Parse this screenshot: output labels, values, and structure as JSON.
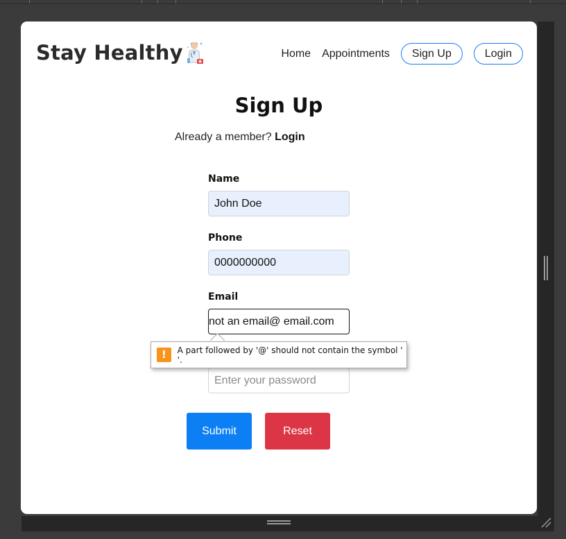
{
  "brand": {
    "name": "Stay Healthy",
    "logo_icon": "doctor-icon"
  },
  "nav": {
    "home": "Home",
    "appointments": "Appointments",
    "signup": "Sign Up",
    "login": "Login"
  },
  "form": {
    "title": "Sign Up",
    "member_prompt": "Already a member?",
    "member_link": "Login",
    "name_label": "Name",
    "name_value": "John Doe",
    "phone_label": "Phone",
    "phone_value": "0000000000",
    "email_label": "Email",
    "email_value": "not an email@ email.com",
    "password_placeholder": "Enter your password",
    "submit": "Submit",
    "reset": "Reset"
  },
  "validation": {
    "icon": "warning-icon",
    "message": "A part followed by '@' should not contain the symbol ' '."
  },
  "colors": {
    "accent": "#0d7ff5",
    "danger": "#dc3646",
    "warning": "#f7941d",
    "autofill": "#e8f0fe"
  }
}
